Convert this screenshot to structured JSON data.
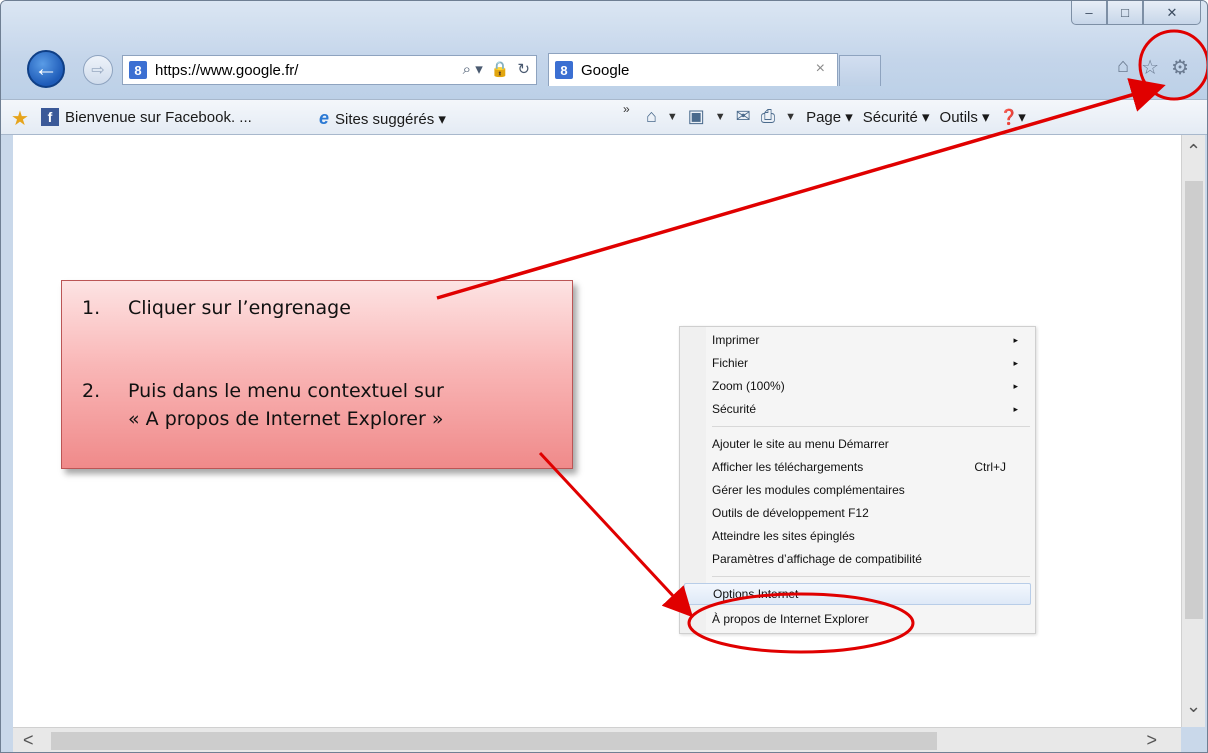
{
  "window": {
    "minimize_glyph": "–",
    "maximize_glyph": "□",
    "close_glyph": "✕"
  },
  "nav": {
    "back_glyph": "←",
    "forward_glyph": "⇨",
    "url_proto": "https://www.",
    "url_host": "google.fr/",
    "search_glyph": "⌕ ▾",
    "lock_glyph": "🔒",
    "refresh_glyph": "↻",
    "tab_label": "Google",
    "tab_close": "×",
    "favicon_letter": "8",
    "home_glyph": "⌂",
    "star_glyph": "☆",
    "gear_glyph": "⚙"
  },
  "command_bar": {
    "favorites": [
      {
        "label": "Bienvenue sur Facebook. ..."
      },
      {
        "label": "Sites suggérés ▾"
      }
    ],
    "chevron": "»",
    "page": "Page ▾",
    "securite": "Sécurité ▾",
    "outils": "Outils ▾",
    "help": "❓▾"
  },
  "instructions": {
    "step1_num": "1.",
    "step1_text": "Cliquer sur l’engrenage",
    "step2_num": "2.",
    "step2_text": "Puis dans le menu contextuel  sur",
    "step2_text_line2": "« A propos de Internet Explorer »"
  },
  "context_menu": {
    "group1": [
      {
        "label": "Imprimer",
        "submenu": "▸"
      },
      {
        "label": "Fichier",
        "submenu": "▸"
      },
      {
        "label": "Zoom (100%)",
        "submenu": "▸"
      },
      {
        "label": "Sécurité",
        "submenu": "▸"
      }
    ],
    "group2": [
      {
        "label": "Ajouter le site au menu Démarrer"
      },
      {
        "label": "Afficher les téléchargements",
        "shortcut": "Ctrl+J"
      },
      {
        "label": "Gérer les modules complémentaires"
      },
      {
        "label": "Outils de développement F12"
      },
      {
        "label": "Atteindre les sites épinglés"
      },
      {
        "label": "Paramètres d’affichage de compatibilité"
      }
    ],
    "group3": [
      {
        "label": "Options Internet"
      },
      {
        "label": "À propos de Internet Explorer"
      }
    ]
  },
  "scroll": {
    "up": "⌃",
    "down": "⌄",
    "left": "<",
    "right": ">"
  },
  "colors": {
    "annotation_red": "#e00000",
    "note_top": "#fde3e3",
    "note_bottom": "#f08a8a"
  }
}
